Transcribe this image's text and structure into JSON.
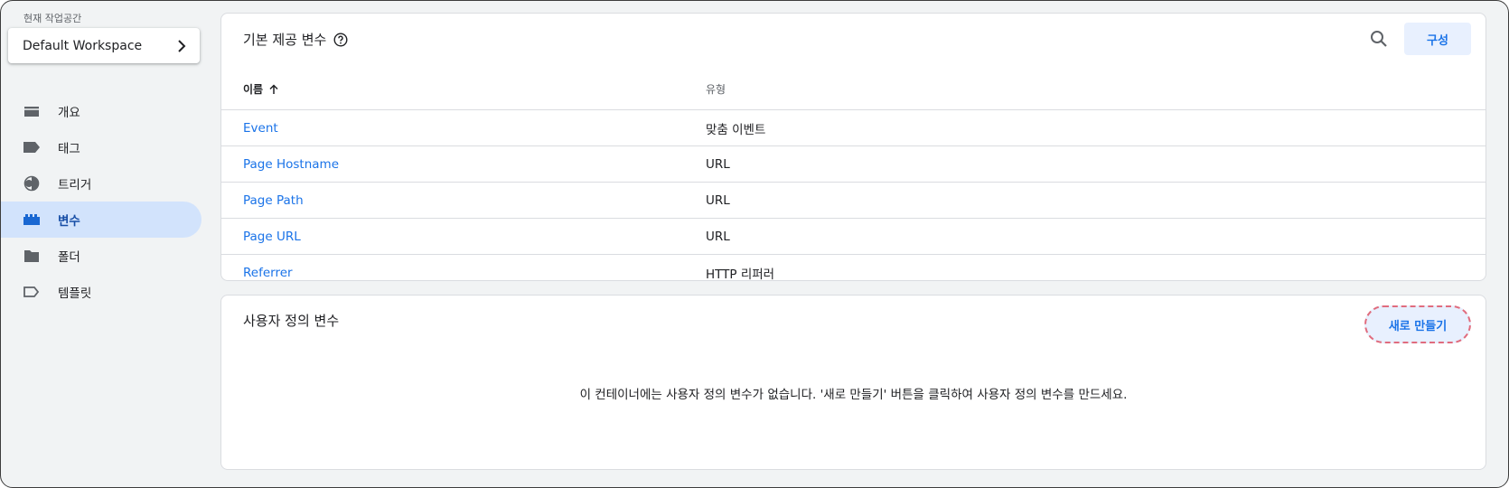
{
  "workspace": {
    "label": "현재 작업공간",
    "name": "Default Workspace"
  },
  "nav": [
    {
      "label": "개요",
      "icon": "overview-icon"
    },
    {
      "label": "태그",
      "icon": "tag-icon"
    },
    {
      "label": "트리거",
      "icon": "trigger-icon"
    },
    {
      "label": "변수",
      "icon": "variables-icon",
      "active": true
    },
    {
      "label": "폴더",
      "icon": "folder-icon"
    },
    {
      "label": "템플릿",
      "icon": "template-icon"
    }
  ],
  "builtin": {
    "title": "기본 제공 변수",
    "config_label": "구성",
    "columns": {
      "name": "이름",
      "type": "유형"
    },
    "rows": [
      {
        "name": "Event",
        "type": "맞춤 이벤트"
      },
      {
        "name": "Page Hostname",
        "type": "URL"
      },
      {
        "name": "Page Path",
        "type": "URL"
      },
      {
        "name": "Page URL",
        "type": "URL"
      },
      {
        "name": "Referrer",
        "type": "HTTP 리퍼러"
      }
    ]
  },
  "custom": {
    "title": "사용자 정의 변수",
    "new_label": "새로 만들기",
    "empty_message": "이 컨테이너에는 사용자 정의 변수가 없습니다. '새로 만들기' 버튼을 클릭하여 사용자 정의 변수를 만드세요."
  },
  "colors": {
    "accent": "#1a73e8",
    "active_nav_bg": "#d2e3fc",
    "highlight_dash": "#e06c7e"
  }
}
